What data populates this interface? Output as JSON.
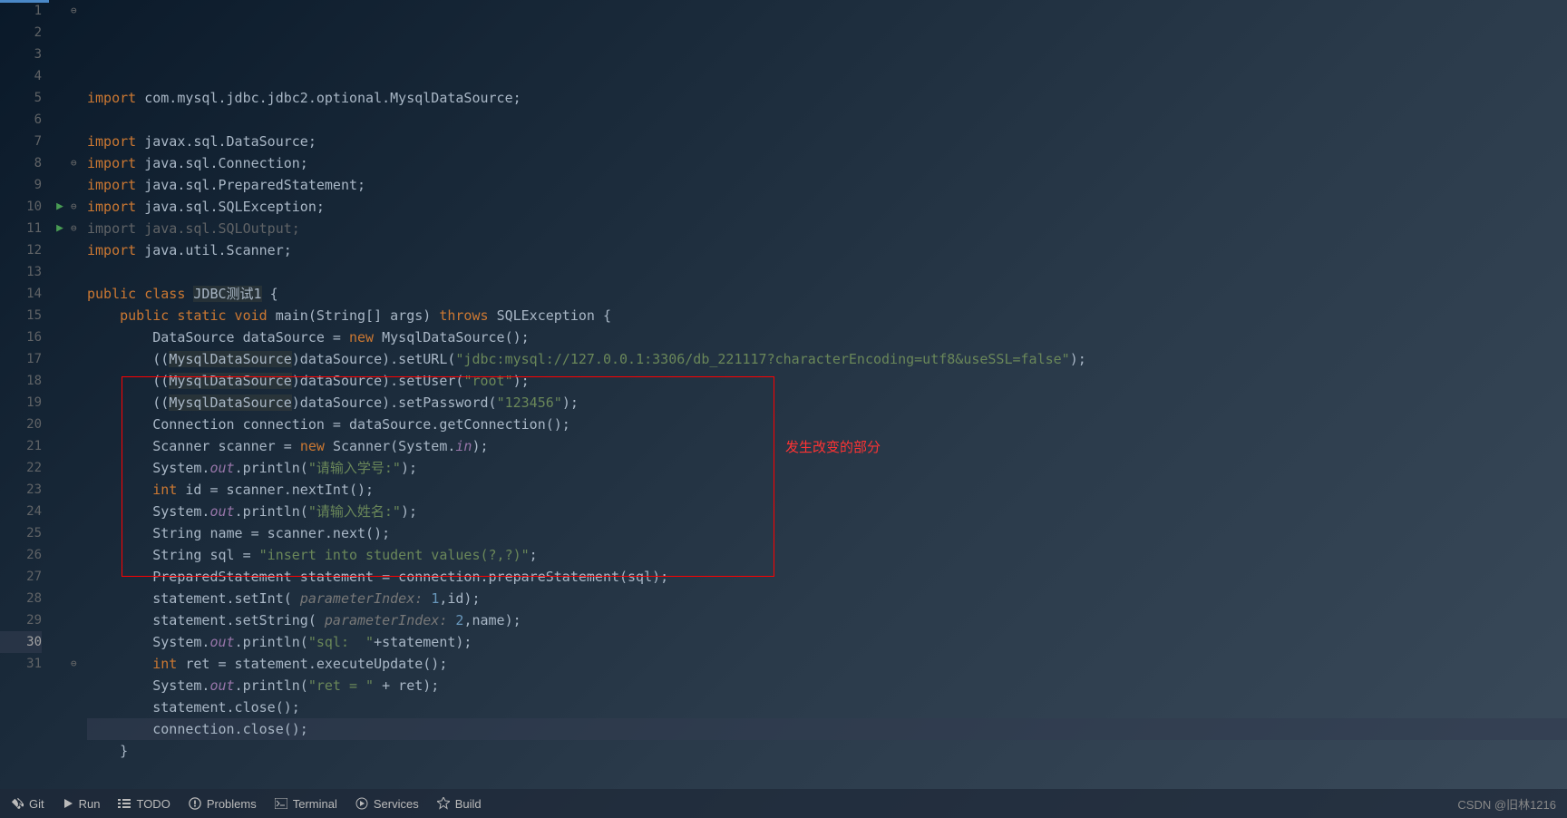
{
  "lines": {
    "1": {
      "tokens": [
        {
          "t": "import ",
          "c": "kw"
        },
        {
          "t": "com.mysql.jdbc.jdbc2.optional.MysqlDataSource;",
          "c": ""
        }
      ]
    },
    "2": {
      "tokens": []
    },
    "3": {
      "tokens": [
        {
          "t": "import ",
          "c": "kw"
        },
        {
          "t": "javax.sql.DataSource;",
          "c": ""
        }
      ]
    },
    "4": {
      "tokens": [
        {
          "t": "import ",
          "c": "kw"
        },
        {
          "t": "java.sql.Connection;",
          "c": ""
        }
      ]
    },
    "5": {
      "tokens": [
        {
          "t": "import ",
          "c": "kw"
        },
        {
          "t": "java.sql.PreparedStatement;",
          "c": ""
        }
      ]
    },
    "6": {
      "tokens": [
        {
          "t": "import ",
          "c": "kw"
        },
        {
          "t": "java.sql.SQLException;",
          "c": ""
        }
      ]
    },
    "7": {
      "tokens": [
        {
          "t": "import java.sql.SQLOutput;",
          "c": "unused"
        }
      ]
    },
    "8": {
      "tokens": [
        {
          "t": "import ",
          "c": "kw"
        },
        {
          "t": "java.util.Scanner;",
          "c": ""
        }
      ]
    },
    "9": {
      "tokens": []
    },
    "10": {
      "tokens": [
        {
          "t": "public class ",
          "c": "kw"
        },
        {
          "t": "JDBC测试1",
          "c": "hl-cls"
        },
        {
          "t": " {",
          "c": ""
        }
      ]
    },
    "11": {
      "tokens": [
        {
          "t": "    ",
          "c": ""
        },
        {
          "t": "public static void ",
          "c": "kw"
        },
        {
          "t": "main",
          "c": "meth"
        },
        {
          "t": "(String[] args) ",
          "c": ""
        },
        {
          "t": "throws ",
          "c": "kw"
        },
        {
          "t": "SQLException {",
          "c": ""
        }
      ]
    },
    "12": {
      "tokens": [
        {
          "t": "        DataSource dataSource = ",
          "c": ""
        },
        {
          "t": "new ",
          "c": "kw"
        },
        {
          "t": "MysqlDataSource();",
          "c": ""
        }
      ]
    },
    "13": {
      "tokens": [
        {
          "t": "        ((",
          "c": ""
        },
        {
          "t": "MysqlDataSource",
          "c": "hl-cls"
        },
        {
          "t": ")dataSource).setURL(",
          "c": ""
        },
        {
          "t": "\"jdbc:mysql://127.0.0.1:3306/db_221117?characterEncoding=utf8&useSSL=false\"",
          "c": "str"
        },
        {
          "t": ");",
          "c": ""
        }
      ]
    },
    "14": {
      "tokens": [
        {
          "t": "        ((",
          "c": ""
        },
        {
          "t": "MysqlDataSource",
          "c": "hl-cls"
        },
        {
          "t": ")dataSource).setUser(",
          "c": ""
        },
        {
          "t": "\"root\"",
          "c": "str"
        },
        {
          "t": ");",
          "c": ""
        }
      ]
    },
    "15": {
      "tokens": [
        {
          "t": "        ((",
          "c": ""
        },
        {
          "t": "MysqlDataSource",
          "c": "hl-cls"
        },
        {
          "t": ")dataSource).setPassword(",
          "c": ""
        },
        {
          "t": "\"123456\"",
          "c": "str"
        },
        {
          "t": ");",
          "c": ""
        }
      ]
    },
    "16": {
      "tokens": [
        {
          "t": "        Connection connection = dataSource.getConnection();",
          "c": ""
        }
      ]
    },
    "17": {
      "tokens": [
        {
          "t": "        Scanner scanner = ",
          "c": ""
        },
        {
          "t": "new ",
          "c": "kw"
        },
        {
          "t": "Scanner(System.",
          "c": ""
        },
        {
          "t": "in",
          "c": "field"
        },
        {
          "t": ");",
          "c": ""
        }
      ]
    },
    "18": {
      "tokens": [
        {
          "t": "        System.",
          "c": ""
        },
        {
          "t": "out",
          "c": "field"
        },
        {
          "t": ".println(",
          "c": ""
        },
        {
          "t": "\"请输入学号:\"",
          "c": "str"
        },
        {
          "t": ");",
          "c": ""
        }
      ]
    },
    "19": {
      "tokens": [
        {
          "t": "        ",
          "c": ""
        },
        {
          "t": "int ",
          "c": "kw"
        },
        {
          "t": "id = scanner.nextInt();",
          "c": ""
        }
      ]
    },
    "20": {
      "tokens": [
        {
          "t": "        System.",
          "c": ""
        },
        {
          "t": "out",
          "c": "field"
        },
        {
          "t": ".println(",
          "c": ""
        },
        {
          "t": "\"请输入姓名:\"",
          "c": "str"
        },
        {
          "t": ");",
          "c": ""
        }
      ]
    },
    "21": {
      "tokens": [
        {
          "t": "        String name = scanner.next();",
          "c": ""
        }
      ]
    },
    "22": {
      "tokens": [
        {
          "t": "        String sql = ",
          "c": ""
        },
        {
          "t": "\"insert into student values(?,?)\"",
          "c": "str"
        },
        {
          "t": ";",
          "c": ""
        }
      ]
    },
    "23": {
      "tokens": [
        {
          "t": "        PreparedStatement statement = connection.prepareStatement(sql);",
          "c": ""
        }
      ]
    },
    "24": {
      "tokens": [
        {
          "t": "        statement.setInt( ",
          "c": ""
        },
        {
          "t": "parameterIndex: ",
          "c": "hint"
        },
        {
          "t": "1",
          "c": "num"
        },
        {
          "t": ",id);",
          "c": ""
        }
      ]
    },
    "25": {
      "tokens": [
        {
          "t": "        statement.setString( ",
          "c": ""
        },
        {
          "t": "parameterIndex: ",
          "c": "hint"
        },
        {
          "t": "2",
          "c": "num"
        },
        {
          "t": ",name);",
          "c": ""
        }
      ]
    },
    "26": {
      "tokens": [
        {
          "t": "        System.",
          "c": ""
        },
        {
          "t": "out",
          "c": "field"
        },
        {
          "t": ".println(",
          "c": ""
        },
        {
          "t": "\"sql:  \"",
          "c": "str"
        },
        {
          "t": "+statement);",
          "c": ""
        }
      ]
    },
    "27": {
      "tokens": [
        {
          "t": "        ",
          "c": ""
        },
        {
          "t": "int ",
          "c": "kw"
        },
        {
          "t": "ret = statement.executeUpdate();",
          "c": ""
        }
      ]
    },
    "28": {
      "tokens": [
        {
          "t": "        System.",
          "c": ""
        },
        {
          "t": "out",
          "c": "field"
        },
        {
          "t": ".println(",
          "c": ""
        },
        {
          "t": "\"ret = \"",
          "c": "str"
        },
        {
          "t": " + ret);",
          "c": ""
        }
      ]
    },
    "29": {
      "tokens": [
        {
          "t": "        statement.close();",
          "c": ""
        }
      ]
    },
    "30": {
      "tokens": [
        {
          "t": "        connection.close();",
          "c": ""
        }
      ]
    },
    "31": {
      "tokens": [
        {
          "t": "    }",
          "c": ""
        }
      ]
    }
  },
  "annotation": {
    "text": "发生改变的部分"
  },
  "highlighted_line": 30,
  "run_markers": [
    10,
    11
  ],
  "fold_markers": {
    "1": "⊖",
    "8": "⊖",
    "10": "⊖",
    "11": "⊖",
    "31": "⊖"
  },
  "status": {
    "git": "Git",
    "run": "Run",
    "todo": "TODO",
    "problems": "Problems",
    "terminal": "Terminal",
    "services": "Services",
    "build": "Build"
  },
  "watermark": "CSDN @旧林1216"
}
